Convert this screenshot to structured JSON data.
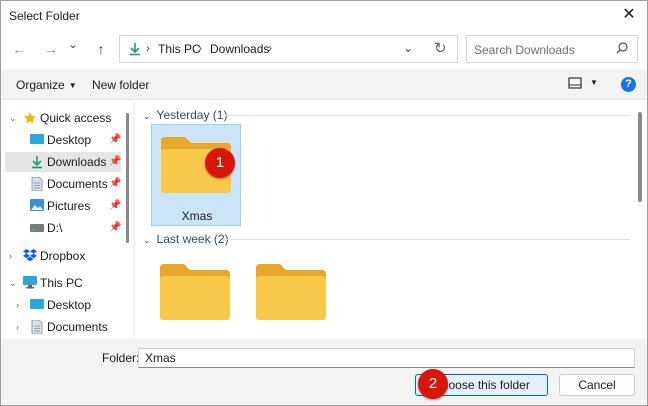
{
  "window": {
    "title": "Select Folder",
    "close_glyph": "✕"
  },
  "nav": {
    "back_glyph": "←",
    "forward_glyph": "→",
    "recent_glyph": "⌄",
    "up_glyph": "↑",
    "breadcrumbs": [
      "This PC",
      "Downloads"
    ],
    "dropdown_glyph": "⌄",
    "refresh_glyph": "↻",
    "search_placeholder": "Search Downloads"
  },
  "toolbar": {
    "organize_label": "Organize",
    "new_folder_label": "New folder",
    "help_label": "?"
  },
  "sidebar": {
    "quick_access": "Quick access",
    "items": [
      {
        "label": "Desktop",
        "icon": "desktop-icon",
        "pinned": true
      },
      {
        "label": "Downloads",
        "icon": "download-icon",
        "pinned": true,
        "selected": true
      },
      {
        "label": "Documents",
        "icon": "documents-icon",
        "pinned": true
      },
      {
        "label": "Pictures",
        "icon": "pictures-icon",
        "pinned": true
      },
      {
        "label": "D:\\",
        "icon": "drive-icon",
        "pinned": true
      }
    ],
    "dropbox": "Dropbox",
    "this_pc": "This PC",
    "pc_items": [
      {
        "label": "Desktop",
        "icon": "desktop-icon"
      },
      {
        "label": "Documents",
        "icon": "documents-icon"
      }
    ]
  },
  "content": {
    "groups": [
      {
        "header": "Yesterday (1)",
        "folders": [
          {
            "name": "Xmas",
            "selected": true
          }
        ]
      },
      {
        "header": "Last week (2)",
        "folders": [
          {
            "name": ""
          },
          {
            "name": ""
          }
        ]
      }
    ],
    "badges": [
      "1",
      "2"
    ]
  },
  "footer": {
    "folder_label": "Folder:",
    "folder_value": "Xmas",
    "choose_label": "Choose this folder",
    "cancel_label": "Cancel"
  },
  "colors": {
    "accent": "#0067c0",
    "badge": "#d8160a",
    "selection": "#cce4f7",
    "folder": "#f8c84a"
  }
}
